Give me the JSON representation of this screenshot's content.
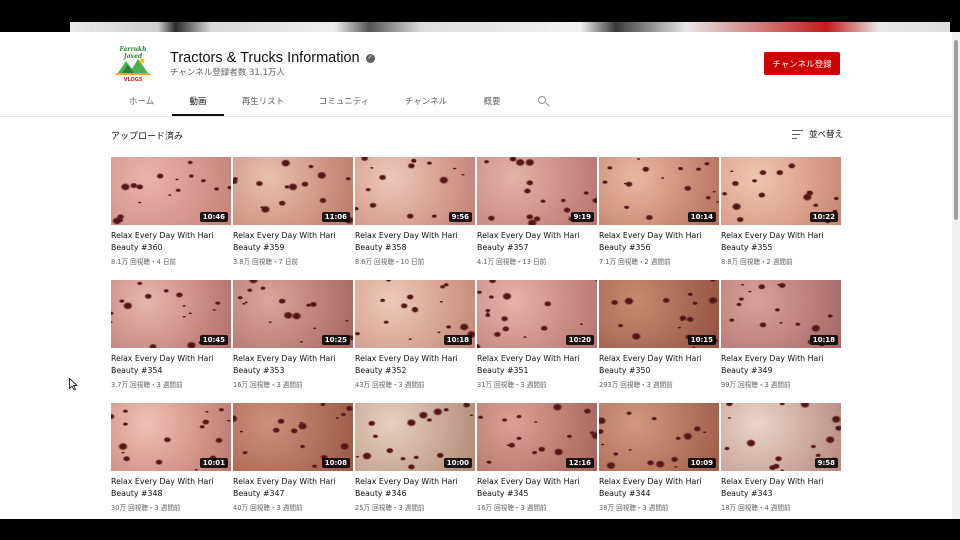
{
  "channel": {
    "name": "Tractors & Trucks Information",
    "subscribers": "チャンネル登録者数 31.1万人",
    "subscribe_label": "チャンネル登録",
    "avatar_top": "Farrukh Javed",
    "avatar_bottom": "VLOGS"
  },
  "tabs": [
    {
      "label": "ホーム",
      "active": false
    },
    {
      "label": "動画",
      "active": true
    },
    {
      "label": "再生リスト",
      "active": false
    },
    {
      "label": "コミュニティ",
      "active": false
    },
    {
      "label": "チャンネル",
      "active": false
    },
    {
      "label": "概要",
      "active": false
    }
  ],
  "section": {
    "title": "アップロード済み",
    "sort_label": "並べ替え"
  },
  "videos": [
    {
      "title": "Relax Every Day With Hari Beauty #360",
      "duration": "10:46",
      "meta": "8.1万 回視聴・4 日前"
    },
    {
      "title": "Relax Every Day With Hari Beauty #359",
      "duration": "11:06",
      "meta": "3.8万 回視聴・7 日前"
    },
    {
      "title": "Relax Every Day With Hari Beauty #358",
      "duration": "9:56",
      "meta": "8.6万 回視聴・10 日前"
    },
    {
      "title": "Relax Every Day With Hari Beauty #357",
      "duration": "9:19",
      "meta": "4.1万 回視聴・13 日前"
    },
    {
      "title": "Relax Every Day With Hari Beauty #356",
      "duration": "10:14",
      "meta": "7.1万 回視聴・2 週間前"
    },
    {
      "title": "Relax Every Day With Hari Beauty #355",
      "duration": "10:22",
      "meta": "8.8万 回視聴・2 週間前"
    },
    {
      "title": "Relax Every Day With Hari Beauty #354",
      "duration": "10:45",
      "meta": "3.7万 回視聴・3 週間前"
    },
    {
      "title": "Relax Every Day With Hari Beauty #353",
      "duration": "10:25",
      "meta": "16万 回視聴・3 週間前"
    },
    {
      "title": "Relax Every Day With Hari Beauty #352",
      "duration": "10:18",
      "meta": "43万 回視聴・3 週間前"
    },
    {
      "title": "Relax Every Day With Hari Beauty #351",
      "duration": "10:20",
      "meta": "31万 回視聴・3 週間前"
    },
    {
      "title": "Relax Every Day With Hari Beauty #350",
      "duration": "10:15",
      "meta": "293万 回視聴・3 週間前"
    },
    {
      "title": "Relax Every Day With Hari Beauty #349",
      "duration": "10:18",
      "meta": "99万 回視聴・3 週間前"
    },
    {
      "title": "Relax Every Day With Hari Beauty #348",
      "duration": "10:01",
      "meta": "30万 回視聴・3 週間前"
    },
    {
      "title": "Relax Every Day With Hari Beauty #347",
      "duration": "10:08",
      "meta": "40万 回視聴・3 週間前"
    },
    {
      "title": "Relax Every Day With Hari Beauty #346",
      "duration": "10:00",
      "meta": "25万 回視聴・3 週間前"
    },
    {
      "title": "Relax Every Day With Hari Beauty #345",
      "duration": "12:16",
      "meta": "16万 回視聴・3 週間前"
    },
    {
      "title": "Relax Every Day With Hari Beauty #344",
      "duration": "10:09",
      "meta": "38万 回視聴・3 週間前"
    },
    {
      "title": "Relax Every Day With Hari Beauty #343",
      "duration": "9:58",
      "meta": "18万 回視聴・4 週間前"
    }
  ],
  "colors": {
    "subscribe": "#cc0000",
    "text": "#0f0f0f",
    "muted": "#606060"
  },
  "icons": {
    "verified": "check-icon",
    "search": "search-icon",
    "sort": "sort-icon"
  }
}
